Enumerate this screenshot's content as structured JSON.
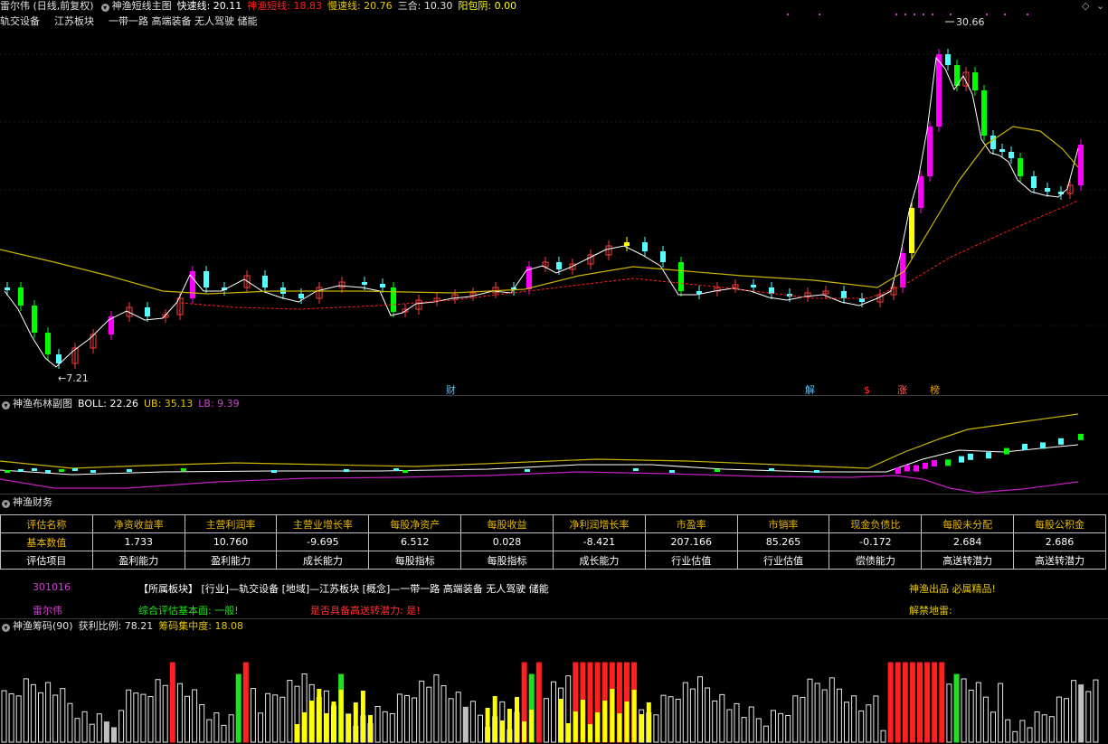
{
  "main_header": {
    "title": "雷尔伟 (日线,前复权)",
    "indicator": "神渔短线主图",
    "fast_label": "快速线: 20.11",
    "mid_label": "神渔短线: 18.83",
    "slow_label": "慢速线: 20.76",
    "sanhe_label": "三合: 10.30",
    "yangbao_label": "阳包阴: 0.00"
  },
  "concepts": [
    "轨交设备",
    "江苏板块",
    "一带一路 高端装备 无人驾驶 储能"
  ],
  "high_label": "30.66",
  "low_label": "←7.21",
  "event_labels": [
    "财",
    "解",
    "$",
    "涨",
    "榜"
  ],
  "boll_header": {
    "title": "神渔布林副图",
    "boll": "BOLL: 22.26",
    "ub": "UB: 35.13",
    "lb": "LB: 9.39"
  },
  "finance": {
    "title": "神渔财务",
    "headers": [
      "评估名称",
      "净资收益率",
      "主营利润率",
      "主营业增长率",
      "每股净资产",
      "每股收益",
      "净利润增长率",
      "市盈率",
      "市销率",
      "现金负债比",
      "每股未分配",
      "每股公积金"
    ],
    "values": [
      "基本数值",
      "1.733",
      "10.760",
      "-9.695",
      "6.512",
      "0.028",
      "-8.421",
      "207.166",
      "85.265",
      "-0.172",
      "2.684",
      "2.686"
    ],
    "items": [
      "评估项目",
      "盈利能力",
      "盈利能力",
      "成长能力",
      "每股指标",
      "每股指标",
      "成长能力",
      "行业估值",
      "行业估值",
      "偿债能力",
      "高送转潜力",
      "高送转潜力"
    ]
  },
  "stock_info": {
    "code": "301016",
    "name": "雷尔伟",
    "sector_line": "【所属板块】 [行业]—轨交设备 [地域]—江苏板块 [概念]—一带一路 高端装备 无人驾驶 储能",
    "summary": "综合评估基本面: 一般!",
    "high_transfer": "是否具备高送转潜力: 是!",
    "product": "神渔出品 必属精品!",
    "unlock": "解禁地雷:"
  },
  "chips_header": {
    "title": "神渔筹码(90)",
    "profit": "获利比例: 78.21",
    "concentration": "筹码集中度: 18.08"
  },
  "colors": {
    "up": "#ff3b3b",
    "up_strong": "#ff00ff",
    "down": "#54ffff",
    "neutral_bar": "#ffff00",
    "green_bar": "#00ff00",
    "fast_line": "#ffffff",
    "slow_line": "#c8b400",
    "short_line": "#ff2020",
    "boll_lb": "#c020c0"
  }
}
